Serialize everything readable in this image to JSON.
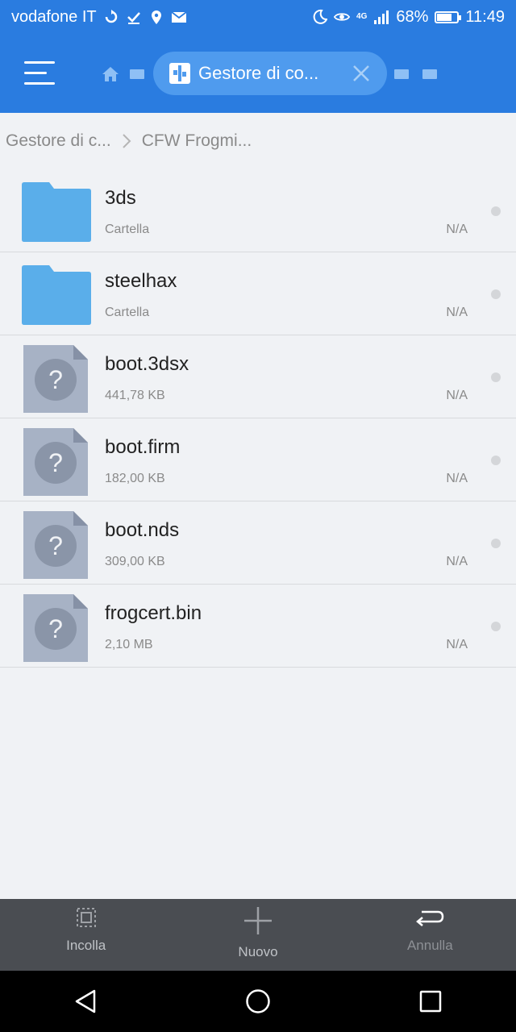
{
  "status_bar": {
    "carrier": "vodafone IT",
    "network": "4G",
    "battery": "68%",
    "time": "11:49"
  },
  "app_bar": {
    "active_tab_label": "Gestore di co...",
    "icons": [
      "menu-icon",
      "home-icon",
      "tab-icon",
      "close-icon"
    ]
  },
  "breadcrumb": {
    "items": [
      "Gestore di c...",
      "CFW Frogmi..."
    ]
  },
  "files": [
    {
      "name": "3ds",
      "info": "Cartella",
      "date": "N/A",
      "type": "folder"
    },
    {
      "name": "steelhax",
      "info": "Cartella",
      "date": "N/A",
      "type": "folder"
    },
    {
      "name": "boot.3dsx",
      "info": "441,78 KB",
      "date": "N/A",
      "type": "unknown"
    },
    {
      "name": "boot.firm",
      "info": "182,00 KB",
      "date": "N/A",
      "type": "unknown"
    },
    {
      "name": "boot.nds",
      "info": "309,00 KB",
      "date": "N/A",
      "type": "unknown"
    },
    {
      "name": "frogcert.bin",
      "info": "2,10 MB",
      "date": "N/A",
      "type": "unknown"
    }
  ],
  "toolbar": {
    "paste_label": "Incolla",
    "new_label": "Nuovo",
    "undo_label": "Annulla"
  },
  "colors": {
    "accent": "#2a7ce0",
    "folder": "#5aaeea",
    "unknown_file": "#a7b2c5",
    "toolbar_bg": "#4a4d52"
  }
}
